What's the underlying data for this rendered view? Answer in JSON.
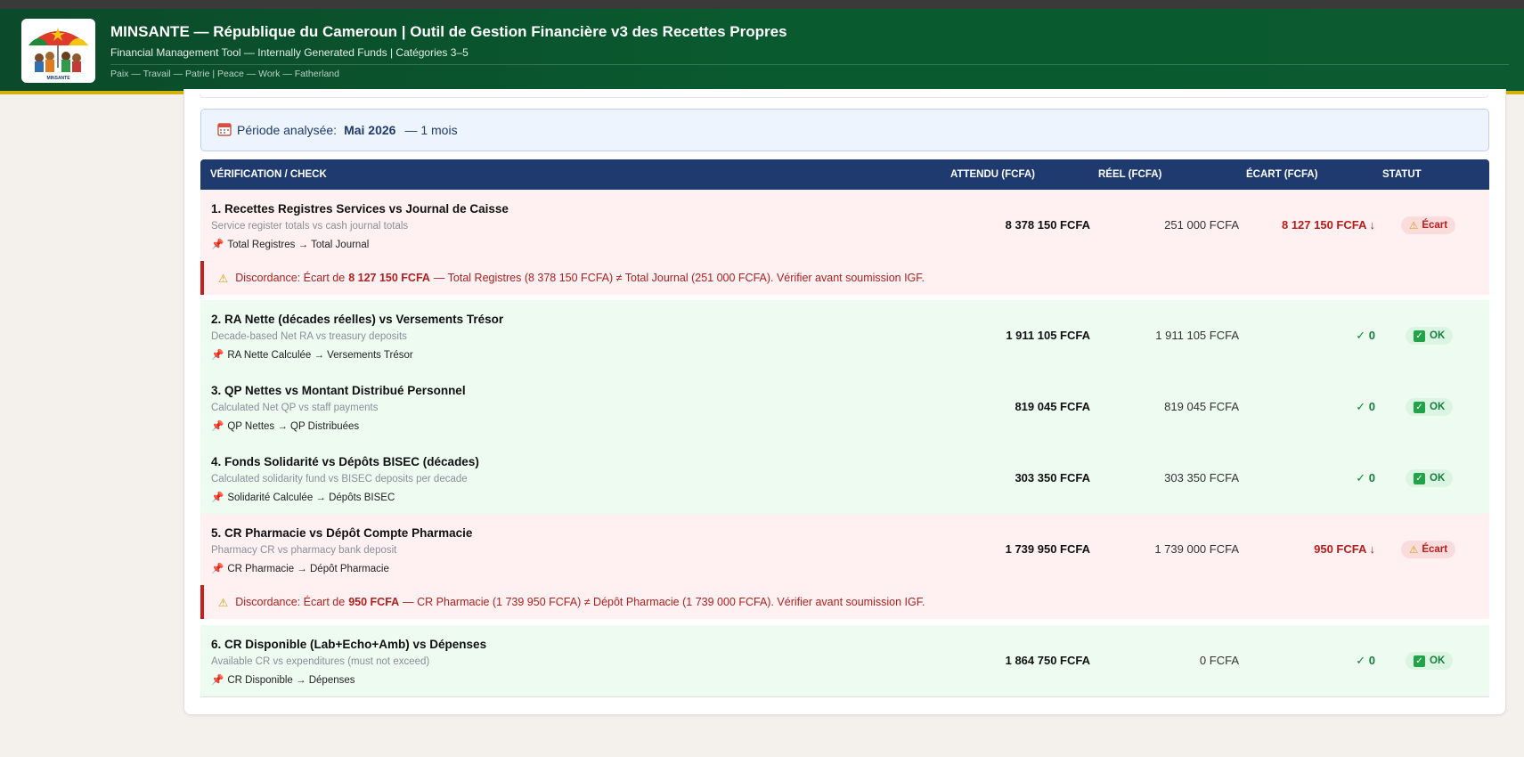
{
  "header": {
    "title": "MINSANTE — République du Cameroun  |  Outil de Gestion Financière v3 des Recettes Propres",
    "subtitle": "Financial Management Tool — Internally Generated Funds | Catégories 3–5",
    "motto": "Paix — Travail — Patrie  |  Peace — Work — Fatherland",
    "logo_text": "MINSANTE"
  },
  "period": {
    "label": "Période analysée:",
    "month": "Mai 2026",
    "duration": "— 1 mois"
  },
  "table": {
    "columns": {
      "check": "VÉRIFICATION / CHECK",
      "expected": "ATTENDU (FCFA)",
      "actual": "RÉEL (FCFA)",
      "gap": "ÉCART (FCFA)",
      "status": "STATUT"
    },
    "rows": [
      {
        "title": "1. Recettes Registres Services vs Journal de Caisse",
        "subtitle": "Service register totals vs cash journal totals",
        "mapping": "Total Registres → Total Journal",
        "expected": "8 378 150 FCFA",
        "actual": "251 000 FCFA",
        "gap": "8 127 150 FCFA ↓",
        "status": "Écart"
      },
      {
        "title": "2. RA Nette (décades réelles) vs Versements Trésor",
        "subtitle": "Decade-based Net RA vs treasury deposits",
        "mapping": "RA Nette Calculée → Versements Trésor",
        "expected": "1 911 105 FCFA",
        "actual": "1 911 105 FCFA",
        "gap": "✓ 0",
        "status": "OK"
      },
      {
        "title": "3. QP Nettes vs Montant Distribué Personnel",
        "subtitle": "Calculated Net QP vs staff payments",
        "mapping": "QP Nettes → QP Distribuées",
        "expected": "819 045 FCFA",
        "actual": "819 045 FCFA",
        "gap": "✓ 0",
        "status": "OK"
      },
      {
        "title": "4. Fonds Solidarité vs Dépôts BISEC (décades)",
        "subtitle": "Calculated solidarity fund vs BISEC deposits per decade",
        "mapping": "Solidarité Calculée → Dépôts BISEC",
        "expected": "303 350 FCFA",
        "actual": "303 350 FCFA",
        "gap": "✓ 0",
        "status": "OK"
      },
      {
        "title": "5. CR Pharmacie vs Dépôt Compte Pharmacie",
        "subtitle": "Pharmacy CR vs pharmacy bank deposit",
        "mapping": "CR Pharmacie → Dépôt Pharmacie",
        "expected": "1 739 950 FCFA",
        "actual": "1 739 000 FCFA",
        "gap": "950 FCFA ↓",
        "status": "Écart"
      },
      {
        "title": "6. CR Disponible (Lab+Echo+Amb) vs Dépenses",
        "subtitle": "Available CR vs expenditures (must not exceed)",
        "mapping": "CR Disponible → Dépenses",
        "expected": "1 864 750 FCFA",
        "actual": "0 FCFA",
        "gap": "✓ 0",
        "status": "OK"
      }
    ],
    "discrepancies": [
      {
        "prefix": "Discordance: Écart de",
        "amount": "8 127 150 FCFA",
        "detail": "— Total Registres (8 378 150 FCFA) ≠ Total Journal (251 000 FCFA). Vérifier avant soumission IGF."
      },
      {
        "prefix": "Discordance: Écart de",
        "amount": "950 FCFA",
        "detail": "— CR Pharmacie (1 739 950 FCFA) ≠ Dépôt Pharmacie (1 739 000 FCFA). Vérifier avant soumission IGF."
      }
    ]
  },
  "colors": {
    "header_green": "#0b4a2a",
    "header_accent": "#d4b10a",
    "table_head": "#1e3a6e",
    "ok_bg": "#edfbf1",
    "bad_bg": "#fff1f1",
    "ok_text": "#15803d",
    "bad_text": "#b91c1c"
  }
}
